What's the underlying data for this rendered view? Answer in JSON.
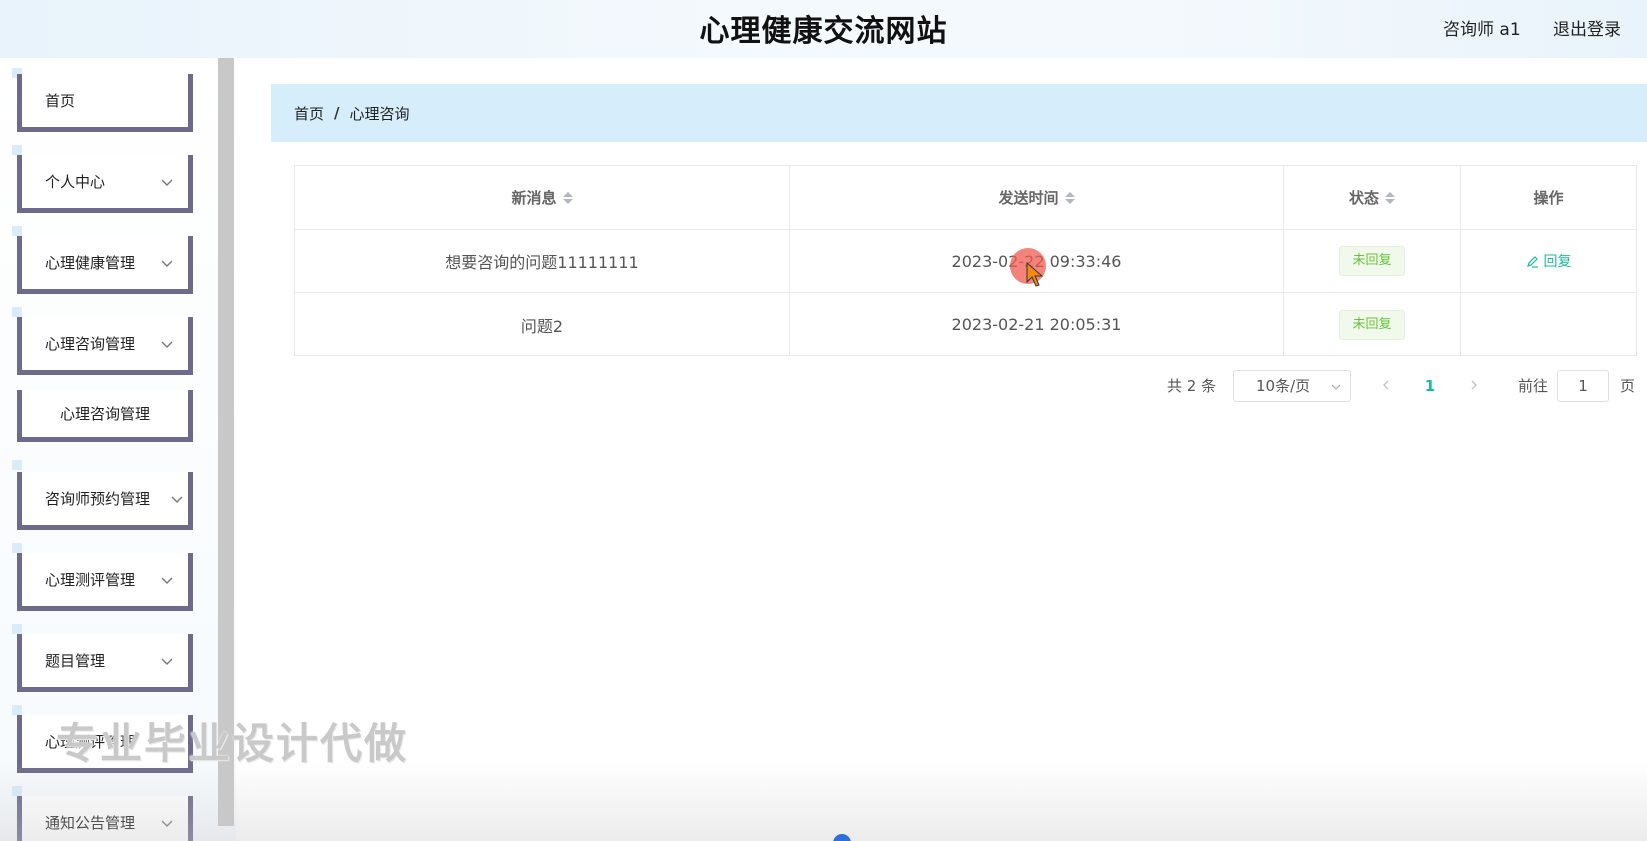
{
  "header": {
    "title": "心理健康交流网站",
    "user": "咨询师 a1",
    "logout": "退出登录"
  },
  "sidebar": {
    "items": [
      {
        "label": "首页"
      },
      {
        "label": "个人中心"
      },
      {
        "label": "心理健康管理"
      },
      {
        "label": "心理咨询管理"
      },
      {
        "label": "心理咨询管理"
      },
      {
        "label": "咨询师预约管理"
      },
      {
        "label": "心理测评管理"
      },
      {
        "label": "题目管理"
      },
      {
        "label": "心理测评管理"
      },
      {
        "label": "通知公告管理"
      }
    ]
  },
  "breadcrumb": {
    "home": "首页",
    "separator": "/",
    "current": "心理咨询"
  },
  "table": {
    "columns": [
      "新消息",
      "发送时间",
      "状态",
      "操作"
    ],
    "rows": [
      {
        "message": "想要咨询的问题11111111",
        "time": "2023-02-22 09:33:46",
        "status": "未回复",
        "action": "回复"
      },
      {
        "message": "问题2",
        "time": "2023-02-21 20:05:31",
        "status": "未回复",
        "action": ""
      }
    ]
  },
  "pagination": {
    "total": "共 2 条",
    "page_size": "10条/页",
    "current_page": "1",
    "goto_label": "前往",
    "goto_value": "1",
    "page_suffix": "页"
  },
  "overlay": {
    "watermark": "专业毕业设计代做"
  },
  "colors": {
    "accent": "#1abc9c",
    "sidebar_border": "#6d6a8b",
    "breadcrumb_bg": "#d6edfb",
    "status_green": "#67c23a"
  }
}
